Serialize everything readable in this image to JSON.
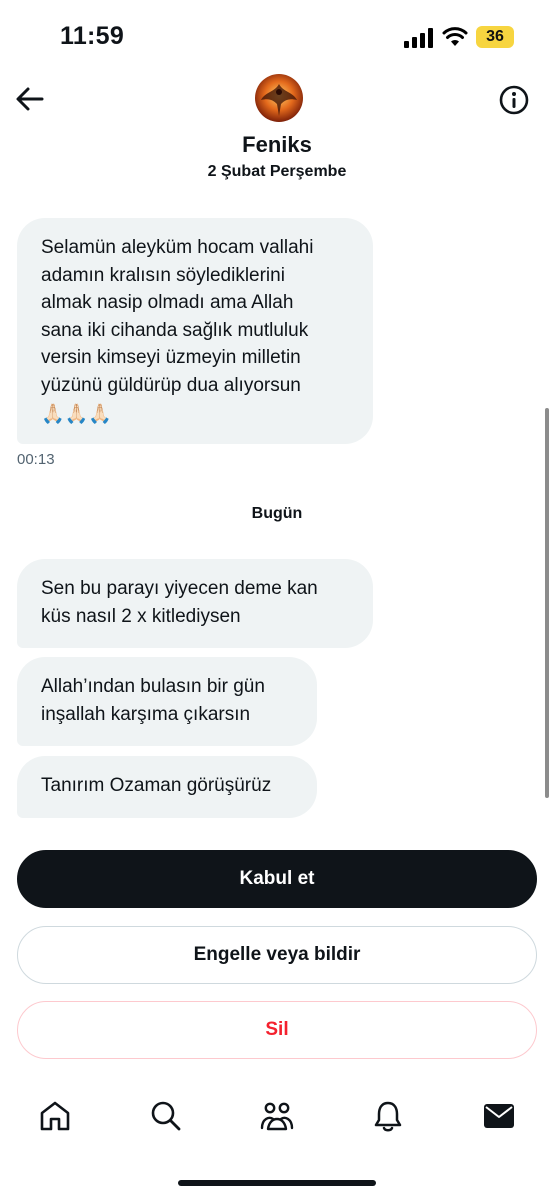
{
  "status_bar": {
    "time": "11:59",
    "battery": "36",
    "battery_color": "#f7d540"
  },
  "header": {
    "contact_name": "Feniks",
    "back_icon": "arrow-left-icon",
    "info_icon": "info-circle-icon"
  },
  "conversation": {
    "date_separator_1": "2 Şubat Perşembe",
    "message_1": {
      "lines": [
        "Selamün aleyküm hocam vallahi",
        "adamın kralısın söylediklerini",
        "almak nasip olmadı ama Allah",
        "sana iki cihanda sağlık mutluluk",
        "versin kimseyi üzmeyin milletin",
        "yüzünü güldürüp dua alıyorsun"
      ],
      "emoji": "🙏🏻🙏🏻🙏🏻",
      "time": "00:13"
    },
    "date_separator_2": "Bugün",
    "message_2": {
      "lines": [
        "Sen bu parayı yiyecen deme kan",
        "küs nasıl 2 x kitlediysen"
      ]
    },
    "message_3": {
      "lines": [
        "Allah’ından bulasın bir gün",
        "inşallah karşıma çıkarsın"
      ]
    },
    "message_4": {
      "lines": [
        "Tanırım Ozaman görüşürüz"
      ]
    }
  },
  "actions": {
    "accept_label": "Kabul et",
    "block_report_label": "Engelle veya bildir",
    "delete_label": "Sil",
    "delete_color": "#f4212e"
  },
  "tabbar": {
    "icons": [
      "home-icon",
      "search-icon",
      "communities-icon",
      "notifications-icon",
      "messages-icon"
    ]
  }
}
